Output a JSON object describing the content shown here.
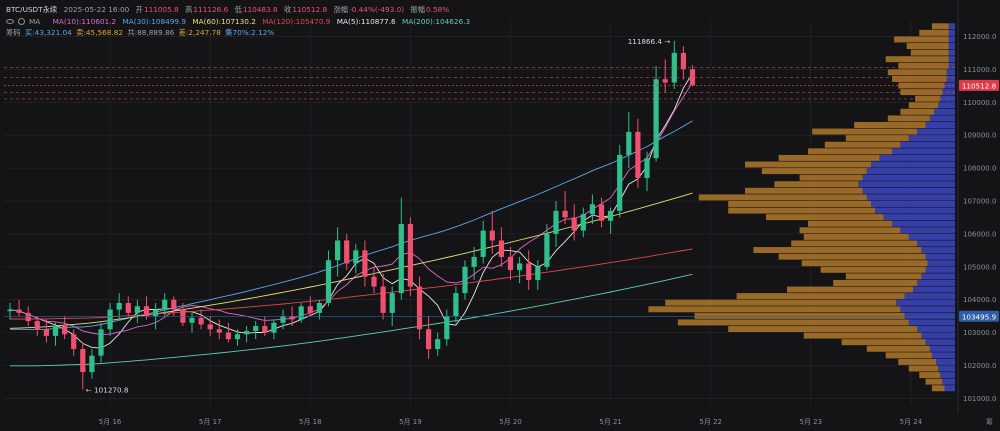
{
  "header": {
    "symbol": "BTC/USDT永续",
    "datetime": "2025-05-22 16:00",
    "open_label": "开",
    "open": "111005.8",
    "high_label": "高",
    "high": "111126.6",
    "low_label": "低",
    "low": "110483.8",
    "close_label": "收",
    "close": "110512.8",
    "change_label": "涨幅",
    "change": "-0.44%(-493.0)",
    "amp_label": "振幅",
    "amp": "0.58%"
  },
  "ma_row": {
    "label": "MA",
    "items": [
      {
        "text": "MA(10):110601.2",
        "color": "#d86bd0"
      },
      {
        "text": "MA(30):108499.9",
        "color": "#5aa8e6"
      },
      {
        "text": "MA(60):107130.2",
        "color": "#e8e07a"
      },
      {
        "text": "MA(120):105470.9",
        "color": "#e04848"
      },
      {
        "text": "MA(5):110877.6",
        "color": "#e8e8e8"
      },
      {
        "text": "MA(200):104626.3",
        "color": "#5fd0b8"
      }
    ]
  },
  "chip_row": {
    "label": "筹码",
    "items": [
      {
        "text": "买:43,321.04",
        "color": "#5aa8e6"
      },
      {
        "text": "卖:45,568.82",
        "color": "#e0a23a"
      },
      {
        "text": "共:88,889.86",
        "color": "#9aa0a8"
      },
      {
        "text": "差:2,247.78",
        "color": "#e0a23a"
      },
      {
        "text": "集70%:2.12%",
        "color": "#5aa8e6"
      }
    ]
  },
  "colors": {
    "up": "#2fbf8c",
    "down": "#f0506e",
    "bg": "#141416",
    "grid": "#26272b",
    "buy": "#3a44b8",
    "sell": "#b0782c"
  },
  "chart_data": {
    "type": "candlestick",
    "ylim": [
      100800,
      112500
    ],
    "y_ticks": [
      101000,
      102000,
      103000,
      104000,
      105000,
      106000,
      107000,
      108000,
      109000,
      110000,
      111000,
      112000
    ],
    "x_ticks": [
      "5月 16",
      "5月 17",
      "5月 18",
      "5月 19",
      "5月 20",
      "5月 21",
      "5月 22",
      "5月 23",
      "5月 24",
      "5月 25"
    ],
    "x_tick_index": [
      11,
      22,
      33,
      44,
      55,
      66,
      77,
      88,
      99,
      110
    ],
    "candles": [
      [
        103650,
        103900,
        103400,
        103700
      ],
      [
        103700,
        104000,
        103500,
        103600
      ],
      [
        103600,
        103800,
        103200,
        103350
      ],
      [
        103350,
        103500,
        102900,
        103100
      ],
      [
        103100,
        103400,
        102700,
        102900
      ],
      [
        102900,
        103300,
        102600,
        103200
      ],
      [
        103200,
        103500,
        102800,
        102950
      ],
      [
        102950,
        103100,
        102300,
        102500
      ],
      [
        102500,
        102700,
        101270,
        101800
      ],
      [
        101800,
        102500,
        101600,
        102300
      ],
      [
        102300,
        103300,
        102100,
        103100
      ],
      [
        103100,
        103900,
        102900,
        103700
      ],
      [
        103700,
        104200,
        103400,
        103900
      ],
      [
        103900,
        104100,
        103500,
        103600
      ],
      [
        103600,
        104000,
        103300,
        103800
      ],
      [
        103800,
        104100,
        103400,
        103500
      ],
      [
        103500,
        103900,
        103100,
        103700
      ],
      [
        103700,
        104200,
        103500,
        104000
      ],
      [
        104000,
        104100,
        103500,
        103700
      ],
      [
        103700,
        103900,
        103200,
        103300
      ],
      [
        103300,
        103600,
        103000,
        103450
      ],
      [
        103450,
        103700,
        103100,
        103250
      ],
      [
        103250,
        103500,
        102900,
        103100
      ],
      [
        103100,
        103400,
        102800,
        103000
      ],
      [
        103000,
        103300,
        102700,
        102800
      ],
      [
        102800,
        103100,
        102600,
        102950
      ],
      [
        102950,
        103200,
        102700,
        103050
      ],
      [
        103050,
        103350,
        102800,
        103200
      ],
      [
        103200,
        103500,
        102900,
        103000
      ],
      [
        103000,
        103400,
        102800,
        103300
      ],
      [
        103300,
        103700,
        103100,
        103500
      ],
      [
        103500,
        103800,
        103200,
        103400
      ],
      [
        103400,
        103900,
        103300,
        103800
      ],
      [
        103800,
        104100,
        103500,
        103600
      ],
      [
        103600,
        104000,
        103400,
        103900
      ],
      [
        103900,
        105500,
        103800,
        105200
      ],
      [
        105200,
        106200,
        104700,
        105800
      ],
      [
        105800,
        106000,
        104900,
        105100
      ],
      [
        105100,
        105700,
        104800,
        105500
      ],
      [
        105500,
        105800,
        104400,
        104700
      ],
      [
        104700,
        105000,
        104200,
        104400
      ],
      [
        104400,
        104800,
        103400,
        103600
      ],
      [
        103600,
        104400,
        103200,
        104200
      ],
      [
        104200,
        107100,
        104000,
        106300
      ],
      [
        106300,
        106500,
        104100,
        104400
      ],
      [
        104400,
        104700,
        102800,
        103100
      ],
      [
        103100,
        103500,
        102200,
        102500
      ],
      [
        102500,
        103000,
        102300,
        102800
      ],
      [
        102800,
        103700,
        102600,
        103500
      ],
      [
        103500,
        104400,
        103300,
        104200
      ],
      [
        104200,
        105200,
        104000,
        105000
      ],
      [
        105000,
        105600,
        104600,
        105300
      ],
      [
        105300,
        106400,
        105100,
        106100
      ],
      [
        106100,
        106700,
        105400,
        105800
      ],
      [
        105800,
        106200,
        105000,
        105300
      ],
      [
        105300,
        105600,
        104600,
        104900
      ],
      [
        104900,
        105300,
        104500,
        105100
      ],
      [
        105100,
        105500,
        104300,
        104600
      ],
      [
        104600,
        105200,
        104300,
        105000
      ],
      [
        105000,
        106300,
        104900,
        106000
      ],
      [
        106000,
        107000,
        105600,
        106700
      ],
      [
        106700,
        107300,
        106300,
        106500
      ],
      [
        106500,
        106900,
        105800,
        106100
      ],
      [
        106100,
        106800,
        105900,
        106600
      ],
      [
        106600,
        107200,
        106300,
        106900
      ],
      [
        106900,
        107100,
        106200,
        106400
      ],
      [
        106400,
        106800,
        106000,
        106700
      ],
      [
        106700,
        108700,
        106500,
        108400
      ],
      [
        108400,
        109700,
        108000,
        109100
      ],
      [
        109100,
        109500,
        107400,
        107700
      ],
      [
        107700,
        108500,
        107300,
        108300
      ],
      [
        108300,
        111100,
        108200,
        110700
      ],
      [
        110700,
        111300,
        110300,
        110600
      ],
      [
        110600,
        111867,
        110400,
        111500
      ],
      [
        111500,
        111700,
        110700,
        111005
      ],
      [
        111005,
        111127,
        110484,
        110513
      ]
    ],
    "ma_series": [
      {
        "name": "MA(5)",
        "value": 110877.6,
        "color": "#e8e8e8"
      },
      {
        "name": "MA(10)",
        "value": 110601.2,
        "color": "#d86bd0"
      },
      {
        "name": "MA(30)",
        "value": 108499.9,
        "color": "#5aa8e6"
      },
      {
        "name": "MA(60)",
        "value": 107130.2,
        "color": "#e8e07a"
      },
      {
        "name": "MA(120)",
        "value": 105470.9,
        "color": "#e04848"
      },
      {
        "name": "MA(200)",
        "value": 104626.3,
        "color": "#5fd0b8"
      }
    ],
    "volume_profile": {
      "bin_size": 200,
      "low": 101200,
      "buy": [
        5,
        6,
        7,
        8,
        9,
        11,
        12,
        14,
        16,
        18,
        22,
        24,
        26,
        28,
        24,
        20,
        18,
        16,
        14,
        13,
        14,
        16,
        18,
        22,
        26,
        30,
        34,
        38,
        40,
        42,
        44,
        46,
        44,
        42,
        40,
        36,
        30,
        26,
        22,
        18,
        14,
        12,
        10,
        8,
        7,
        6,
        5,
        4,
        4,
        3,
        3,
        3,
        3,
        3,
        3,
        3
      ],
      "sell": [
        6,
        8,
        10,
        14,
        18,
        22,
        30,
        40,
        56,
        90,
        110,
        100,
        120,
        110,
        80,
        60,
        40,
        36,
        50,
        60,
        70,
        80,
        60,
        50,
        48,
        40,
        56,
        70,
        68,
        80,
        56,
        40,
        30,
        50,
        60,
        48,
        40,
        36,
        30,
        50,
        34,
        20,
        16,
        14,
        12,
        20,
        22,
        26,
        28,
        24,
        30,
        18,
        20,
        26,
        14,
        8
      ]
    },
    "annotations": [
      {
        "text": "111866.4 →",
        "value": 111866.4
      },
      {
        "text": "← 101270.8",
        "value": 101270.8
      }
    ],
    "price_tags": [
      {
        "text": "110512.8",
        "value": 110512.8,
        "color": "#e03a4a"
      },
      {
        "text": "103495.9",
        "value": 103495.9,
        "color": "#2d5fa8"
      }
    ],
    "dashed_levels": [
      111050,
      110750,
      110300,
      110100
    ]
  }
}
